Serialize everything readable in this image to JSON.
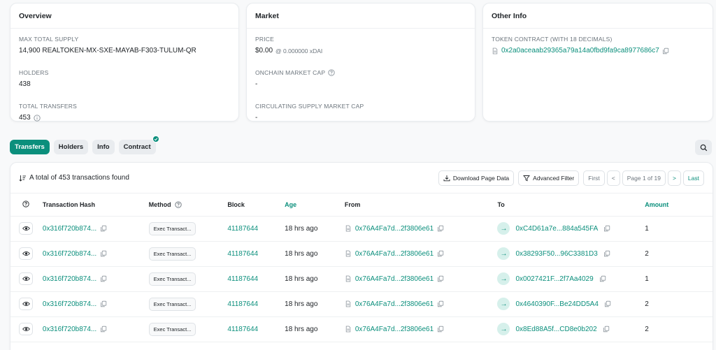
{
  "overview": {
    "title": "Overview",
    "max_supply_label": "MAX TOTAL SUPPLY",
    "max_supply_value": "14,900 REALTOKEN-MX-SXE-MAYAB-F303-TULUM-QR",
    "holders_label": "HOLDERS",
    "holders_value": "438",
    "transfers_label": "TOTAL TRANSFERS",
    "transfers_value": "453"
  },
  "market": {
    "title": "Market",
    "price_label": "PRICE",
    "price_value": "$0.00",
    "price_sub": "@ 0.000000 xDAI",
    "onchain_label": "ONCHAIN MARKET CAP",
    "onchain_value": "-",
    "circulating_label": "CIRCULATING SUPPLY MARKET CAP",
    "circulating_value": "-"
  },
  "other": {
    "title": "Other Info",
    "contract_label": "TOKEN CONTRACT (WITH 18 DECIMALS)",
    "contract_value": "0x2a0aceaab29365a79a14a0fbd9fa9ca8977686c7"
  },
  "tabs": [
    {
      "label": "Transfers"
    },
    {
      "label": "Holders"
    },
    {
      "label": "Info"
    },
    {
      "label": "Contract"
    }
  ],
  "toolbar": {
    "total_text": "A total of 453 transactions found",
    "download_label": "Download Page Data",
    "filter_label": "Advanced Filter",
    "first_label": "First",
    "prev_label": "<",
    "page_label": "Page 1 of 19",
    "next_label": ">",
    "last_label": "Last"
  },
  "columns": {
    "hash": "Transaction Hash",
    "method": "Method",
    "block": "Block",
    "age": "Age",
    "from": "From",
    "to": "To",
    "amount": "Amount"
  },
  "rows": [
    {
      "hash": "0x316f720b874...",
      "method": "Exec Transact...",
      "block": "41187644",
      "age": "18 hrs ago",
      "from": "0x76A4Fa7d...2f3806e61",
      "to": "0xC4D61a7e...884a545FA",
      "amount": "1"
    },
    {
      "hash": "0x316f720b874...",
      "method": "Exec Transact...",
      "block": "41187644",
      "age": "18 hrs ago",
      "from": "0x76A4Fa7d...2f3806e61",
      "to": "0x38293F50...96C3381D3",
      "amount": "2"
    },
    {
      "hash": "0x316f720b874...",
      "method": "Exec Transact...",
      "block": "41187644",
      "age": "18 hrs ago",
      "from": "0x76A4Fa7d...2f3806e61",
      "to": "0x0027421F...2f7Aa4029",
      "amount": "1"
    },
    {
      "hash": "0x316f720b874...",
      "method": "Exec Transact...",
      "block": "41187644",
      "age": "18 hrs ago",
      "from": "0x76A4Fa7d...2f3806e61",
      "to": "0x4640390F...Be24DD5A4",
      "amount": "2"
    },
    {
      "hash": "0x316f720b874...",
      "method": "Exec Transact...",
      "block": "41187644",
      "age": "18 hrs ago",
      "from": "0x76A4Fa7d...2f3806e61",
      "to": "0x8Ed88A5f...CD8e0b202",
      "amount": "2"
    }
  ],
  "colors": {
    "accent": "#0b8f7c",
    "muted": "#6c757d"
  }
}
